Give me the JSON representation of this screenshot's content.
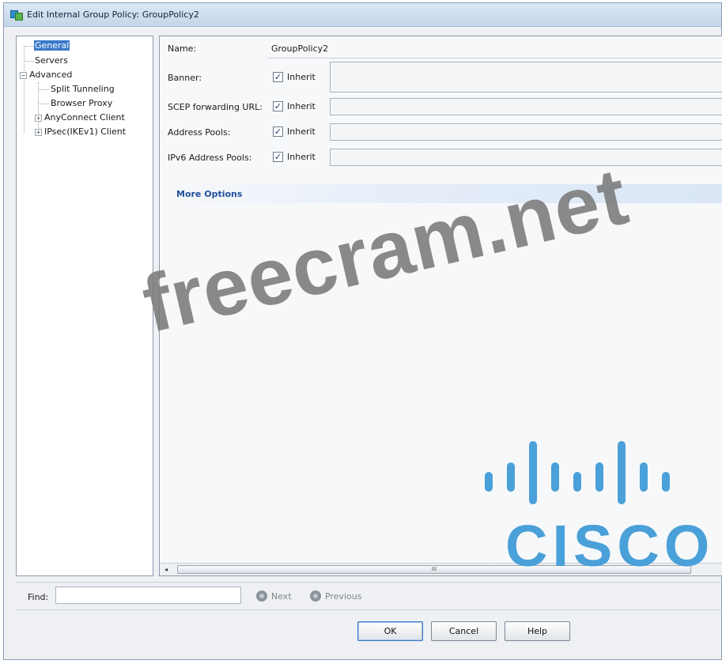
{
  "window": {
    "title": "Edit Internal Group Policy: GroupPolicy2"
  },
  "tree": {
    "items": [
      {
        "label": "General",
        "selected": true,
        "expander": ""
      },
      {
        "label": "Servers",
        "selected": false,
        "expander": ""
      },
      {
        "label": "Advanced",
        "selected": false,
        "expander": "−"
      },
      {
        "label": "Split Tunneling",
        "selected": false,
        "expander": ""
      },
      {
        "label": "Browser Proxy",
        "selected": false,
        "expander": ""
      },
      {
        "label": "AnyConnect Client",
        "selected": false,
        "expander": "+"
      },
      {
        "label": "IPsec(IKEv1) Client",
        "selected": false,
        "expander": "+"
      }
    ]
  },
  "form": {
    "name_label": "Name:",
    "name_value": "GroupPolicy2",
    "banner_label": "Banner:",
    "scep_label": "SCEP forwarding URL:",
    "address_pools_label": "Address Pools:",
    "ipv6_pools_label": "IPv6 Address Pools:",
    "inherit_label": "Inherit",
    "checkmark": "✓",
    "more_options": "More Options"
  },
  "scrollbar": {
    "left_arrow": "◂",
    "grip": "III"
  },
  "findbar": {
    "find_label": "Find:",
    "find_value": "",
    "next_label": "Next",
    "previous_label": "Previous"
  },
  "buttons": {
    "ok": "OK",
    "cancel": "Cancel",
    "help": "Help"
  },
  "watermark": {
    "text": "freecram.net"
  },
  "logo": {
    "wordmark": "CISCO",
    "color": "#4aa0d8"
  }
}
